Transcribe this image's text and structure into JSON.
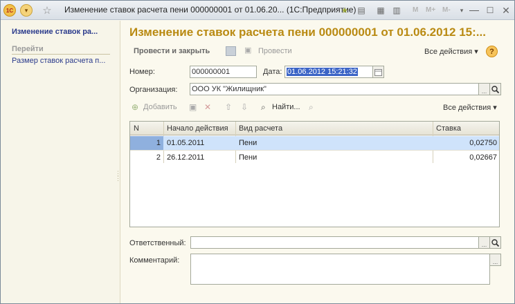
{
  "window": {
    "title": "Изменение ставок расчета пени 000000001 от 01.06.20... (1С:Предприятие)",
    "m_buttons": [
      "M",
      "M+",
      "M-"
    ],
    "logo_text": "1С"
  },
  "sidebar": {
    "current": "Изменение ставок ра...",
    "section": "Перейти",
    "link": "Размер ставок расчета п..."
  },
  "form": {
    "title": "Изменение ставок расчета пени 000000001 от 01.06.2012 15:...",
    "toolbar": {
      "post_close": "Провести и закрыть",
      "post": "Провести",
      "all_actions": "Все действия ▾",
      "help": "?"
    },
    "number_label": "Номер:",
    "number": "000000001",
    "date_label": "Дата:",
    "date": "01.06.2012 15:21:32",
    "org_label": "Организация:",
    "org": "ООО УК \"Жилищник\"",
    "table_toolbar": {
      "add": "Добавить",
      "find": "Найти...",
      "all_actions": "Все действия ▾"
    },
    "table": {
      "columns": [
        "N",
        "Начало действия",
        "Вид расчета",
        "Ставка"
      ],
      "rows": [
        {
          "n": "1",
          "start": "01.05.2011",
          "kind": "Пени",
          "rate": "0,02750"
        },
        {
          "n": "2",
          "start": "26.12.2011",
          "kind": "Пени",
          "rate": "0,02667"
        }
      ]
    },
    "responsible_label": "Ответственный:",
    "responsible": "",
    "comment_label": "Комментарий:",
    "comment": ""
  },
  "colors": {
    "title": "#b98a12",
    "link": "#2b3b8c",
    "selection": "#3b64c6",
    "row_selected": "#cfe3fb"
  }
}
